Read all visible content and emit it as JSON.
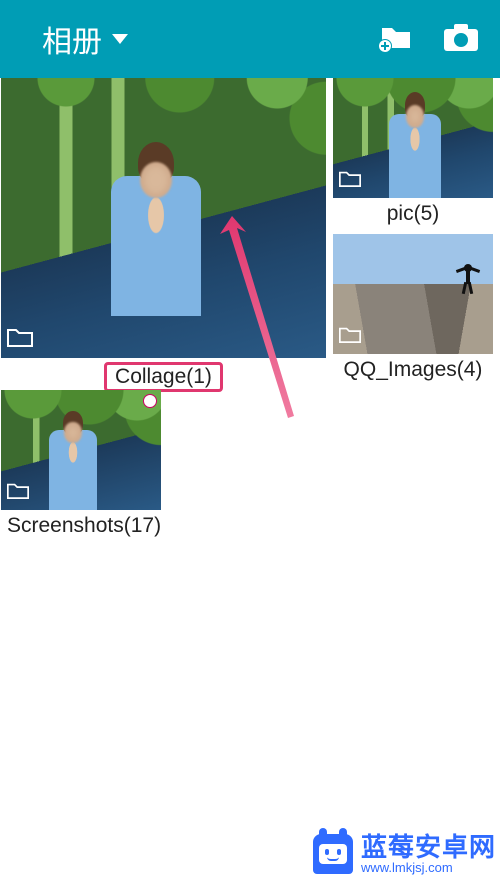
{
  "toolbar": {
    "title": "相册"
  },
  "albums": {
    "collage": {
      "label": "Collage(1)"
    },
    "pic": {
      "label": "pic(5)"
    },
    "qq": {
      "label": "QQ_Images(4)"
    },
    "screenshots": {
      "label": "Screenshots(17)"
    }
  },
  "watermark": {
    "line1": "蓝莓安卓网",
    "line2": "www.lmkjsj.com"
  }
}
